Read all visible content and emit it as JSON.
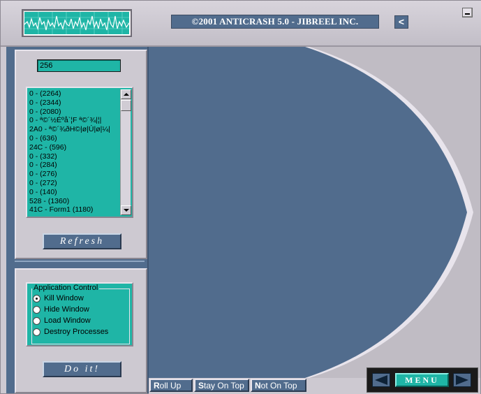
{
  "header": {
    "title": "©2001 ANTICRASH 5.0 - JIBREEL INC.",
    "collapse_label": "<",
    "wave_icon": "waveform-icon"
  },
  "left": {
    "pid_value": "256",
    "process_list": [
      "0 -  (2264)",
      "0 -  (2344)",
      "0 -  (2080)",
      "0 - ª©´½Éºå`¦F ª©´¾|¦|",
      "2A0 - ª©´¾ðH©|ø|Ú|ø|¼|",
      "0 -  (636)",
      "24C -  (596)",
      "0 -  (332)",
      "0 -  (284)",
      "0 -  (276)",
      "0 -  (272)",
      "0 -  (140)",
      "528 -  (1360)",
      "41C - Form1 (1180)"
    ],
    "refresh_label": "Refresh",
    "group_title": "Application Control",
    "options": [
      {
        "label": "Kill Window",
        "checked": true
      },
      {
        "label": "Hide Window",
        "checked": false
      },
      {
        "label": "Load Window",
        "checked": false
      },
      {
        "label": "Destroy Processes",
        "checked": false
      }
    ],
    "doit_label": "Do it!"
  },
  "tabs": {
    "rollup_first": "R",
    "rollup_rest": "oll Up",
    "stay_first": "S",
    "stay_rest": "tay On Top",
    "not_first": "N",
    "not_rest": "ot On Top"
  },
  "menu": {
    "label": "MENU"
  },
  "colors": {
    "accent_teal": "#1fb5a6",
    "panel_blue": "#516c8d",
    "chrome_grey": "#cdc9d1"
  }
}
